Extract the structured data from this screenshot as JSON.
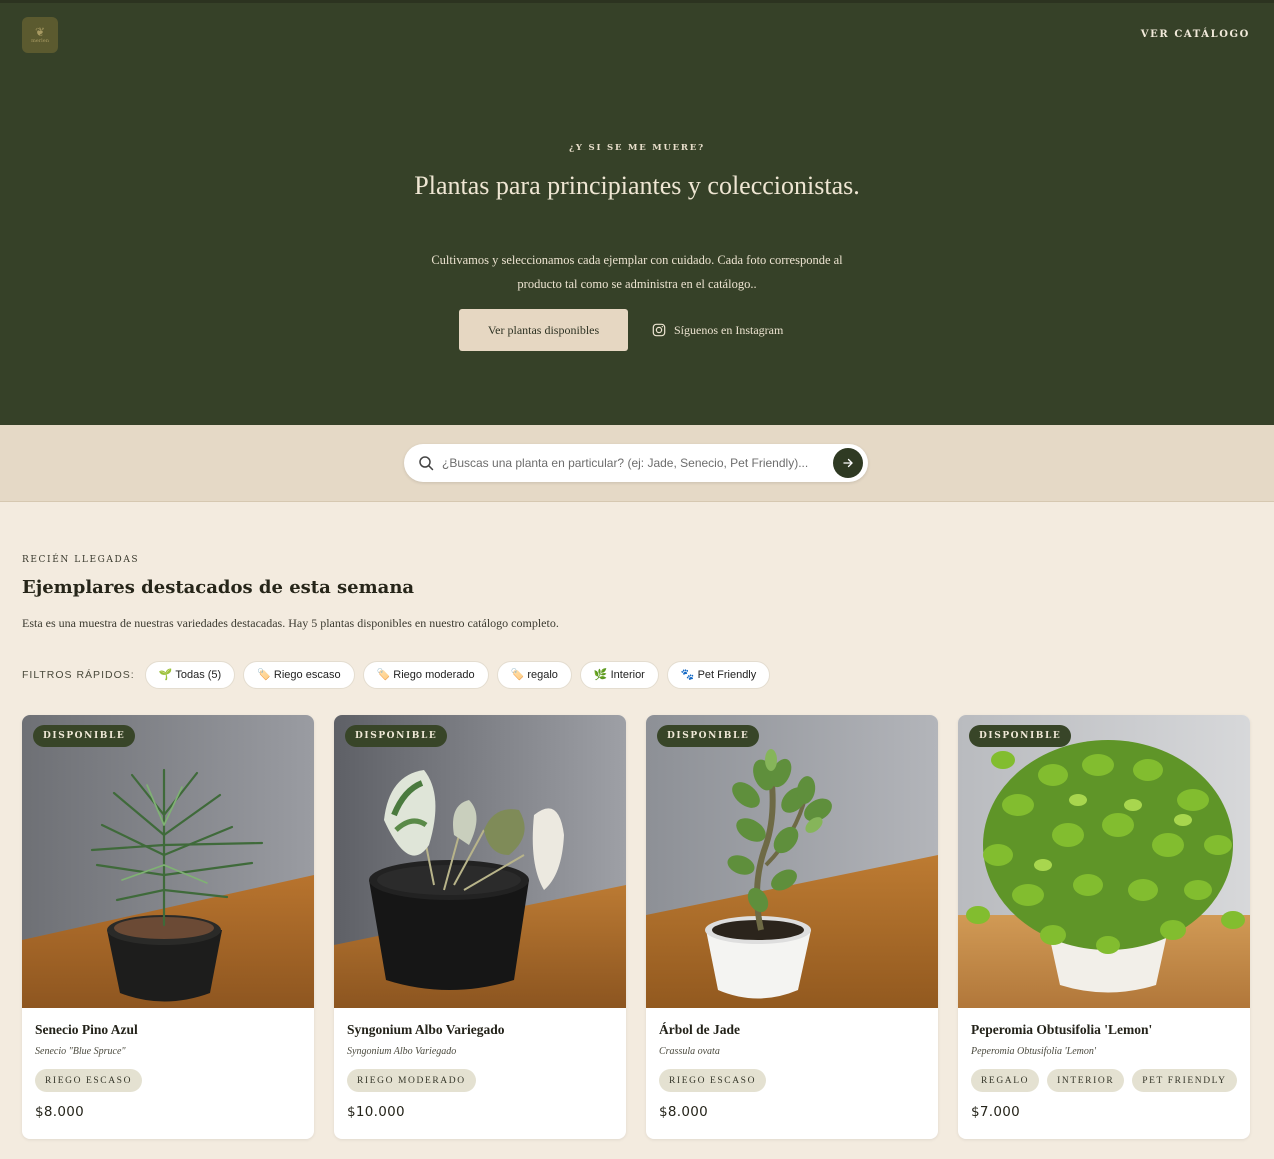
{
  "header": {
    "logo_text": "merlen",
    "nav_catalog": "VER CATÁLOGO"
  },
  "hero": {
    "eyebrow": "¿Y SI SE ME MUERE?",
    "title": "Plantas para principiantes y coleccionistas.",
    "subtitle": "Cultivamos y seleccionamos cada ejemplar con cuidado. Cada foto corresponde al producto tal como se administra en el catálogo..",
    "primary_button": "Ver plantas disponibles",
    "instagram_button": "Síguenos en Instagram"
  },
  "search": {
    "placeholder": "¿Buscas una planta en particular? (ej: Jade, Senecio, Pet Friendly)..."
  },
  "section": {
    "eyebrow": "RECIÉN LLEGADAS",
    "title": "Ejemplares destacados de esta semana",
    "description": "Esta es una muestra de nuestras variedades destacadas. Hay 5 plantas disponibles en nuestro catálogo completo."
  },
  "filters": {
    "label": "FILTROS RÁPIDOS:",
    "chips": [
      {
        "icon": "🌱",
        "label": "Todas (5)"
      },
      {
        "icon": "🏷️",
        "label": "Riego escaso"
      },
      {
        "icon": "🏷️",
        "label": "Riego moderado"
      },
      {
        "icon": "🏷️",
        "label": "regalo"
      },
      {
        "icon": "🌿",
        "label": "Interior"
      },
      {
        "icon": "🐾",
        "label": "Pet Friendly"
      }
    ]
  },
  "products": [
    {
      "badge": "DISPONIBLE",
      "name": "Senecio Pino Azul",
      "scientific": "Senecio \"Blue Spruce\"",
      "tags": [
        "RIEGO ESCASO"
      ],
      "price": "$8.000"
    },
    {
      "badge": "DISPONIBLE",
      "name": "Syngonium Albo Variegado",
      "scientific": "Syngonium Albo Variegado",
      "tags": [
        "RIEGO MODERADO"
      ],
      "price": "$10.000"
    },
    {
      "badge": "DISPONIBLE",
      "name": "Árbol de Jade",
      "scientific": "Crassula ovata",
      "tags": [
        "RIEGO ESCASO"
      ],
      "price": "$8.000"
    },
    {
      "badge": "DISPONIBLE",
      "name": "Peperomia Obtusifolia 'Lemon'",
      "scientific": "Peperomia Obtusifolia 'Lemon'",
      "tags": [
        "REGALO",
        "INTERIOR",
        "PET FRIENDLY"
      ],
      "price": "$7.000"
    }
  ],
  "colors": {
    "hero_bg": "#364128",
    "page_bg": "#f3ebdf",
    "search_band_bg": "#e5d9c6",
    "accent_dark": "#384528",
    "button_beige": "#e6d7c2"
  }
}
